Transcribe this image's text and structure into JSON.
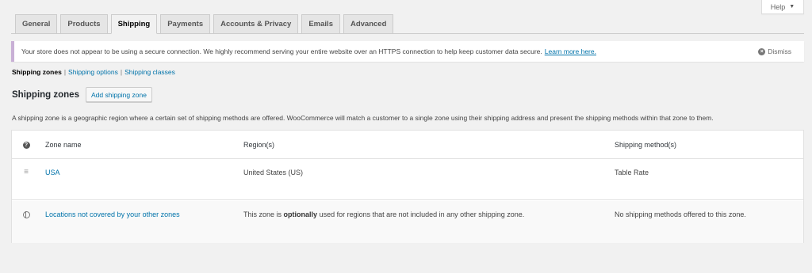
{
  "help": {
    "label": "Help"
  },
  "tabs": [
    {
      "label": "General",
      "active": false
    },
    {
      "label": "Products",
      "active": false
    },
    {
      "label": "Shipping",
      "active": true
    },
    {
      "label": "Payments",
      "active": false
    },
    {
      "label": "Accounts & Privacy",
      "active": false
    },
    {
      "label": "Emails",
      "active": false
    },
    {
      "label": "Advanced",
      "active": false
    }
  ],
  "notice": {
    "text": "Your store does not appear to be using a secure connection. We highly recommend serving your entire website over an HTTPS connection to help keep customer data secure.",
    "link": "Learn more here.",
    "dismiss": "Dismiss",
    "border_color": "#c9b0d6"
  },
  "subnav": {
    "current": "Shipping zones",
    "separator": "|",
    "options": "Shipping options",
    "classes": "Shipping classes"
  },
  "page": {
    "title": "Shipping zones",
    "add_button": "Add shipping zone",
    "description": "A shipping zone is a geographic region where a certain set of shipping methods are offered. WooCommerce will match a customer to a single zone using their shipping address and present the shipping methods within that zone to them."
  },
  "table": {
    "headers": {
      "name": "Zone name",
      "regions": "Region(s)",
      "methods": "Shipping method(s)"
    },
    "zones": [
      {
        "name": "USA",
        "regions": "United States (US)",
        "methods": "Table Rate"
      }
    ],
    "other": {
      "name": "Locations not covered by your other zones",
      "regions_pre": "This zone is",
      "regions_bold": "optionally",
      "regions_post": "used for regions that are not included in any other shipping zone.",
      "methods": "No shipping methods offered to this zone."
    }
  },
  "colors": {
    "link": "#0073aa",
    "background": "#f1f1f1"
  }
}
